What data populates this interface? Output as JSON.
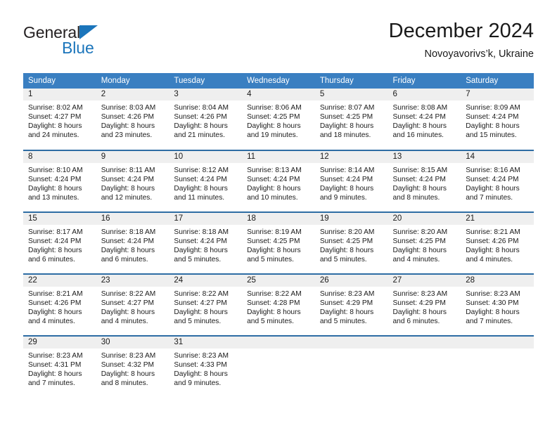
{
  "brand": {
    "word1": "General",
    "word2": "Blue",
    "logo_color": "#1b75bb"
  },
  "header": {
    "title": "December 2024",
    "subtitle": "Novoyavorivs’k, Ukraine"
  },
  "theme": {
    "header_bg": "#3a7fc1",
    "row_divider": "#2e6da4",
    "daynum_bg": "#efefef"
  },
  "weekday_headers": [
    "Sunday",
    "Monday",
    "Tuesday",
    "Wednesday",
    "Thursday",
    "Friday",
    "Saturday"
  ],
  "weeks": [
    [
      {
        "day": "1",
        "sunrise": "Sunrise: 8:02 AM",
        "sunset": "Sunset: 4:27 PM",
        "daylight_line1": "Daylight: 8 hours",
        "daylight_line2": "and 24 minutes."
      },
      {
        "day": "2",
        "sunrise": "Sunrise: 8:03 AM",
        "sunset": "Sunset: 4:26 PM",
        "daylight_line1": "Daylight: 8 hours",
        "daylight_line2": "and 23 minutes."
      },
      {
        "day": "3",
        "sunrise": "Sunrise: 8:04 AM",
        "sunset": "Sunset: 4:26 PM",
        "daylight_line1": "Daylight: 8 hours",
        "daylight_line2": "and 21 minutes."
      },
      {
        "day": "4",
        "sunrise": "Sunrise: 8:06 AM",
        "sunset": "Sunset: 4:25 PM",
        "daylight_line1": "Daylight: 8 hours",
        "daylight_line2": "and 19 minutes."
      },
      {
        "day": "5",
        "sunrise": "Sunrise: 8:07 AM",
        "sunset": "Sunset: 4:25 PM",
        "daylight_line1": "Daylight: 8 hours",
        "daylight_line2": "and 18 minutes."
      },
      {
        "day": "6",
        "sunrise": "Sunrise: 8:08 AM",
        "sunset": "Sunset: 4:24 PM",
        "daylight_line1": "Daylight: 8 hours",
        "daylight_line2": "and 16 minutes."
      },
      {
        "day": "7",
        "sunrise": "Sunrise: 8:09 AM",
        "sunset": "Sunset: 4:24 PM",
        "daylight_line1": "Daylight: 8 hours",
        "daylight_line2": "and 15 minutes."
      }
    ],
    [
      {
        "day": "8",
        "sunrise": "Sunrise: 8:10 AM",
        "sunset": "Sunset: 4:24 PM",
        "daylight_line1": "Daylight: 8 hours",
        "daylight_line2": "and 13 minutes."
      },
      {
        "day": "9",
        "sunrise": "Sunrise: 8:11 AM",
        "sunset": "Sunset: 4:24 PM",
        "daylight_line1": "Daylight: 8 hours",
        "daylight_line2": "and 12 minutes."
      },
      {
        "day": "10",
        "sunrise": "Sunrise: 8:12 AM",
        "sunset": "Sunset: 4:24 PM",
        "daylight_line1": "Daylight: 8 hours",
        "daylight_line2": "and 11 minutes."
      },
      {
        "day": "11",
        "sunrise": "Sunrise: 8:13 AM",
        "sunset": "Sunset: 4:24 PM",
        "daylight_line1": "Daylight: 8 hours",
        "daylight_line2": "and 10 minutes."
      },
      {
        "day": "12",
        "sunrise": "Sunrise: 8:14 AM",
        "sunset": "Sunset: 4:24 PM",
        "daylight_line1": "Daylight: 8 hours",
        "daylight_line2": "and 9 minutes."
      },
      {
        "day": "13",
        "sunrise": "Sunrise: 8:15 AM",
        "sunset": "Sunset: 4:24 PM",
        "daylight_line1": "Daylight: 8 hours",
        "daylight_line2": "and 8 minutes."
      },
      {
        "day": "14",
        "sunrise": "Sunrise: 8:16 AM",
        "sunset": "Sunset: 4:24 PM",
        "daylight_line1": "Daylight: 8 hours",
        "daylight_line2": "and 7 minutes."
      }
    ],
    [
      {
        "day": "15",
        "sunrise": "Sunrise: 8:17 AM",
        "sunset": "Sunset: 4:24 PM",
        "daylight_line1": "Daylight: 8 hours",
        "daylight_line2": "and 6 minutes."
      },
      {
        "day": "16",
        "sunrise": "Sunrise: 8:18 AM",
        "sunset": "Sunset: 4:24 PM",
        "daylight_line1": "Daylight: 8 hours",
        "daylight_line2": "and 6 minutes."
      },
      {
        "day": "17",
        "sunrise": "Sunrise: 8:18 AM",
        "sunset": "Sunset: 4:24 PM",
        "daylight_line1": "Daylight: 8 hours",
        "daylight_line2": "and 5 minutes."
      },
      {
        "day": "18",
        "sunrise": "Sunrise: 8:19 AM",
        "sunset": "Sunset: 4:25 PM",
        "daylight_line1": "Daylight: 8 hours",
        "daylight_line2": "and 5 minutes."
      },
      {
        "day": "19",
        "sunrise": "Sunrise: 8:20 AM",
        "sunset": "Sunset: 4:25 PM",
        "daylight_line1": "Daylight: 8 hours",
        "daylight_line2": "and 5 minutes."
      },
      {
        "day": "20",
        "sunrise": "Sunrise: 8:20 AM",
        "sunset": "Sunset: 4:25 PM",
        "daylight_line1": "Daylight: 8 hours",
        "daylight_line2": "and 4 minutes."
      },
      {
        "day": "21",
        "sunrise": "Sunrise: 8:21 AM",
        "sunset": "Sunset: 4:26 PM",
        "daylight_line1": "Daylight: 8 hours",
        "daylight_line2": "and 4 minutes."
      }
    ],
    [
      {
        "day": "22",
        "sunrise": "Sunrise: 8:21 AM",
        "sunset": "Sunset: 4:26 PM",
        "daylight_line1": "Daylight: 8 hours",
        "daylight_line2": "and 4 minutes."
      },
      {
        "day": "23",
        "sunrise": "Sunrise: 8:22 AM",
        "sunset": "Sunset: 4:27 PM",
        "daylight_line1": "Daylight: 8 hours",
        "daylight_line2": "and 4 minutes."
      },
      {
        "day": "24",
        "sunrise": "Sunrise: 8:22 AM",
        "sunset": "Sunset: 4:27 PM",
        "daylight_line1": "Daylight: 8 hours",
        "daylight_line2": "and 5 minutes."
      },
      {
        "day": "25",
        "sunrise": "Sunrise: 8:22 AM",
        "sunset": "Sunset: 4:28 PM",
        "daylight_line1": "Daylight: 8 hours",
        "daylight_line2": "and 5 minutes."
      },
      {
        "day": "26",
        "sunrise": "Sunrise: 8:23 AM",
        "sunset": "Sunset: 4:29 PM",
        "daylight_line1": "Daylight: 8 hours",
        "daylight_line2": "and 5 minutes."
      },
      {
        "day": "27",
        "sunrise": "Sunrise: 8:23 AM",
        "sunset": "Sunset: 4:29 PM",
        "daylight_line1": "Daylight: 8 hours",
        "daylight_line2": "and 6 minutes."
      },
      {
        "day": "28",
        "sunrise": "Sunrise: 8:23 AM",
        "sunset": "Sunset: 4:30 PM",
        "daylight_line1": "Daylight: 8 hours",
        "daylight_line2": "and 7 minutes."
      }
    ],
    [
      {
        "day": "29",
        "sunrise": "Sunrise: 8:23 AM",
        "sunset": "Sunset: 4:31 PM",
        "daylight_line1": "Daylight: 8 hours",
        "daylight_line2": "and 7 minutes."
      },
      {
        "day": "30",
        "sunrise": "Sunrise: 8:23 AM",
        "sunset": "Sunset: 4:32 PM",
        "daylight_line1": "Daylight: 8 hours",
        "daylight_line2": "and 8 minutes."
      },
      {
        "day": "31",
        "sunrise": "Sunrise: 8:23 AM",
        "sunset": "Sunset: 4:33 PM",
        "daylight_line1": "Daylight: 8 hours",
        "daylight_line2": "and 9 minutes."
      },
      {
        "day": "",
        "sunrise": "",
        "sunset": "",
        "daylight_line1": "",
        "daylight_line2": ""
      },
      {
        "day": "",
        "sunrise": "",
        "sunset": "",
        "daylight_line1": "",
        "daylight_line2": ""
      },
      {
        "day": "",
        "sunrise": "",
        "sunset": "",
        "daylight_line1": "",
        "daylight_line2": ""
      },
      {
        "day": "",
        "sunrise": "",
        "sunset": "",
        "daylight_line1": "",
        "daylight_line2": ""
      }
    ]
  ]
}
